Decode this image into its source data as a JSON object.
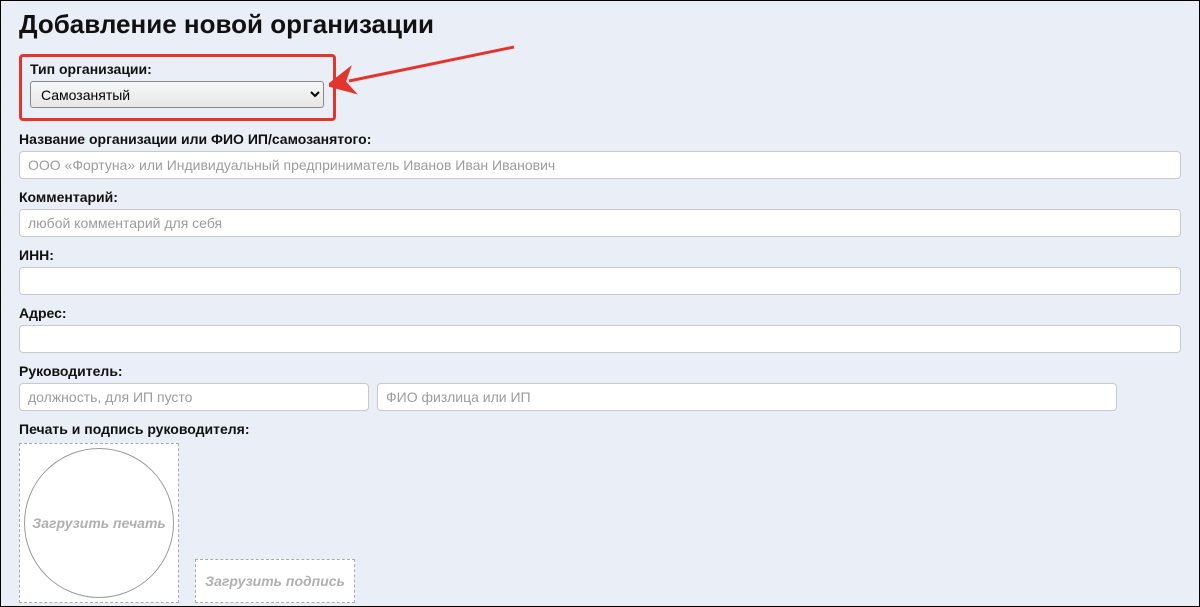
{
  "page": {
    "title": "Добавление новой организации"
  },
  "orgType": {
    "label": "Тип организации:",
    "selected": "Самозанятый"
  },
  "orgName": {
    "label": "Название организации или ФИО ИП/самозанятого:",
    "placeholder": "ООО «Фортуна» или Индивидуальный предприниматель Иванов Иван Иванович",
    "value": ""
  },
  "comment": {
    "label": "Комментарий:",
    "placeholder": "любой комментарий для себя",
    "value": ""
  },
  "inn": {
    "label": "ИНН:",
    "placeholder": "",
    "value": ""
  },
  "address": {
    "label": "Адрес:",
    "placeholder": "",
    "value": ""
  },
  "head": {
    "label": "Руководитель:",
    "position_placeholder": "должность, для ИП пусто",
    "position_value": "",
    "name_placeholder": "ФИО физлица или ИП",
    "name_value": ""
  },
  "stamp": {
    "label": "Печать и подпись руководителя:",
    "upload_stamp": "Загрузить печать",
    "upload_sign": "Загрузить подпись"
  },
  "colors": {
    "highlight": "#e3352e",
    "bg": "#eaeff7"
  }
}
